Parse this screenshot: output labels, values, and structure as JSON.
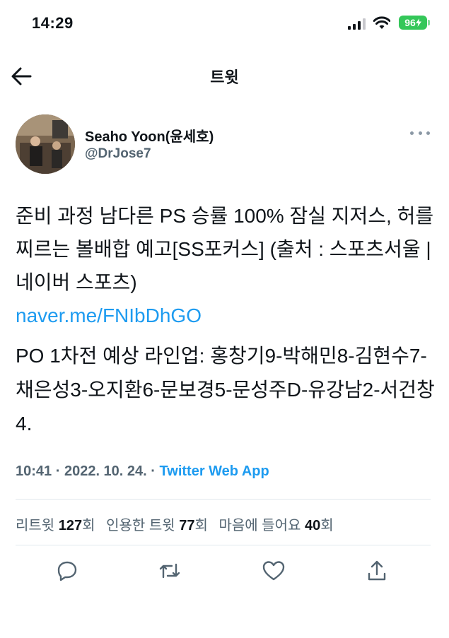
{
  "status_bar": {
    "time": "14:29",
    "battery": "96"
  },
  "nav": {
    "title": "트윗"
  },
  "author": {
    "name": "Seaho Yoon(윤세호)",
    "handle": "@DrJose7"
  },
  "tweet": {
    "text_main": "준비 과정 남다른 PS 승률 100% 잠실 지저스, 허를 찌르는 볼배합 예고[SS포커스] (출처 : 스포츠서울 | 네이버 스포츠)",
    "link": "naver.me/FNIbDhGO",
    "text_lineup": "PO 1차전 예상 라인업: 홍창기9-박해민8-김현수7-채은성3-오지환6-문보경5-문성주D-유강남2-서건창4."
  },
  "meta": {
    "time": "10:41",
    "date": "2022. 10. 24.",
    "separator": "·",
    "source": "Twitter Web App"
  },
  "stats": {
    "retweets_label": "리트윗",
    "retweets_count": "127",
    "retweets_unit": "회",
    "quotes_label": "인용한 트윗",
    "quotes_count": "77",
    "quotes_unit": "회",
    "likes_label": "마음에 들어요",
    "likes_count": "40",
    "likes_unit": "회"
  },
  "icons": {
    "back": "arrow-left-icon",
    "more": "more-icon",
    "reply": "reply-icon",
    "retweet": "retweet-icon",
    "like": "heart-icon",
    "share": "share-icon"
  },
  "colors": {
    "accent": "#1d9bf0",
    "battery": "#34c759",
    "secondary_text": "#536471"
  }
}
